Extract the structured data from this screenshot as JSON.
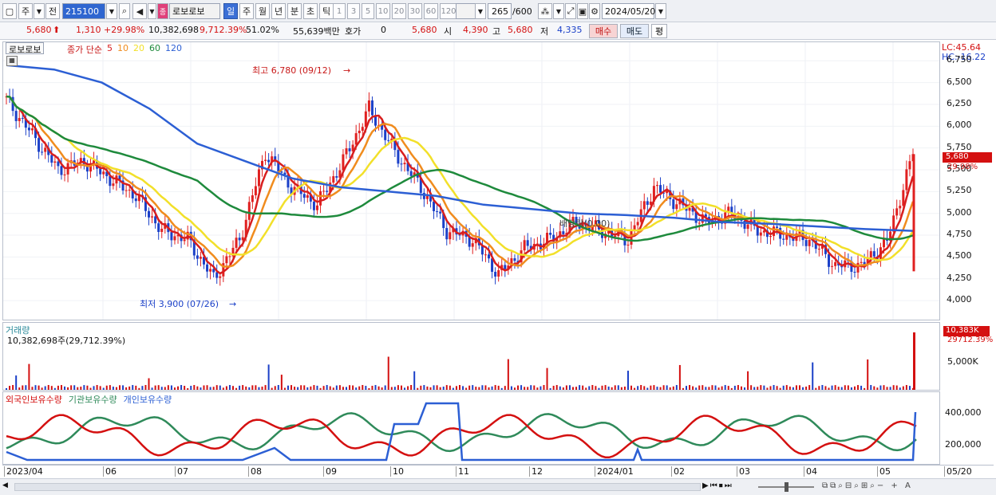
{
  "toolbar": {
    "period_prefix": "주",
    "prev_label": "전",
    "code": "215100",
    "stock_name": "로보로보",
    "name_badge": "종",
    "periods": [
      "일",
      "주",
      "월",
      "년",
      "분",
      "초",
      "틱"
    ],
    "minutes": [
      "1",
      "3",
      "5",
      "10",
      "20",
      "30",
      "60",
      "120"
    ],
    "count": "265",
    "count_max": "/600",
    "date": "2024/05/20"
  },
  "quote": {
    "price": "5,680",
    "change": "1,310",
    "change_pct": "+29.98%",
    "volume": "10,382,698",
    "volume_pct": "9,712.39%",
    "turnover": "51.02%",
    "amount": "55,639백만",
    "bid_label": "호가",
    "bid_value": "0",
    "bid_price": "5,680",
    "open_label": "시",
    "open": "4,390",
    "high_label": "고",
    "high": "5,680",
    "low_label": "저",
    "low": "4,335",
    "buy_label": "매수",
    "sell_label": "매도",
    "avg_label": "평"
  },
  "legend": {
    "name": "로보로보",
    "ma_label": "종가 단순",
    "ma": [
      "5",
      "10",
      "20",
      "60",
      "120"
    ],
    "ma_colors": [
      "#d81e1e",
      "#f08c1e",
      "#f2e02a",
      "#1e8a3c",
      "#2c5fd4"
    ]
  },
  "price_axis": {
    "lc": "LC:45.64",
    "hc": "HC:-16.22",
    "ticks": [
      "6,750",
      "6,500",
      "6,250",
      "6,000",
      "5,750",
      "5,500",
      "5,250",
      "5,000",
      "4,750",
      "4,500",
      "4,250",
      "4,000"
    ],
    "current": "5,680",
    "current_pct": "29.98%"
  },
  "annotations": {
    "high": "최고 6,780 (09/12)",
    "low": "최저 3,900 (07/26)",
    "dividend": "배당락(0.00)"
  },
  "volume": {
    "title": "거래량",
    "value": "10,382,698주(29,712.39%)",
    "tick": "5,000K",
    "current": "10,383K",
    "current_pct": "29712.39%"
  },
  "holdings": {
    "series": [
      "외국인보유수량",
      "기관보유수량",
      "개인보유수량"
    ],
    "colors": [
      "#d41010",
      "#2f8a5a",
      "#2c5fd4"
    ],
    "ticks": [
      "400,000",
      "200,000"
    ]
  },
  "x_axis": [
    "2023/04",
    "06",
    "07",
    "08",
    "09",
    "10",
    "11",
    "12",
    "2024/01",
    "02",
    "03",
    "04",
    "05",
    "05/20"
  ],
  "chart_data": {
    "type": "line",
    "title": "로보로보",
    "y_range": [
      3900,
      6780
    ],
    "price_high": 6780,
    "price_low": 3900,
    "last_close": 5680,
    "approx_close": [
      6300,
      5900,
      5500,
      5600,
      5400,
      5200,
      4800,
      4700,
      4250,
      4700,
      5700,
      5300,
      5100,
      5600,
      6200,
      5700,
      5300,
      4800,
      4700,
      4300,
      4600,
      4700,
      4900,
      4800,
      4700,
      5300,
      5100,
      4900,
      5000,
      4800,
      4750,
      4700,
      4400,
      4400,
      4680,
      5680
    ],
    "ma120_approx": [
      6700,
      6650,
      6500,
      6200,
      5800,
      5600,
      5400,
      5300,
      5250,
      5200,
      5100,
      5050,
      5000,
      4980,
      4950,
      4900,
      4880,
      4850,
      4820,
      4800
    ],
    "volume_last": "10,383K"
  }
}
